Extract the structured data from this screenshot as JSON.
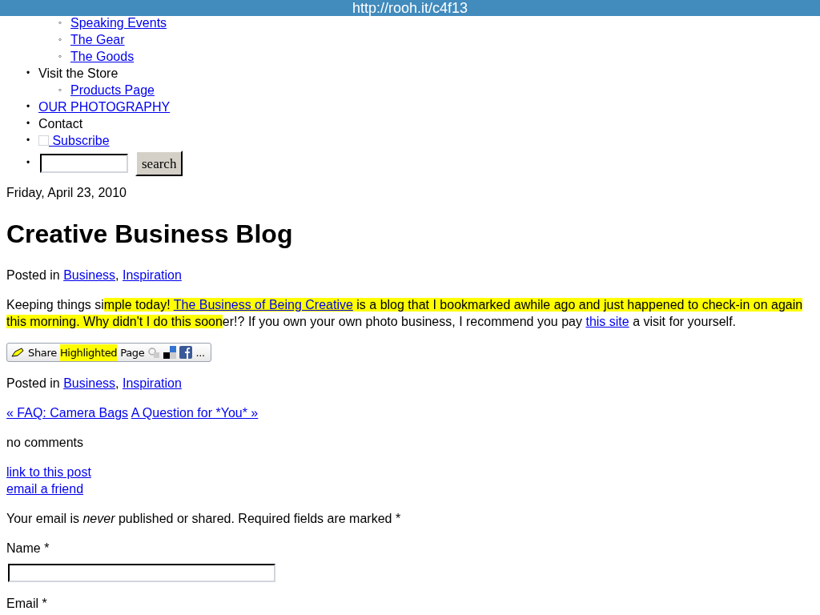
{
  "top_bar": {
    "url": "http://rooh.it/c4f13"
  },
  "nav": [
    {
      "marker": "◦",
      "label": "Speaking Events",
      "kind": "link"
    },
    {
      "marker": "◦",
      "label": "The Gear",
      "kind": "link"
    },
    {
      "marker": "◦",
      "label": "The Goods",
      "kind": "link"
    }
  ],
  "nav_main": [
    {
      "marker": "•",
      "label": "Visit the Store",
      "kind": "text",
      "children": [
        {
          "marker": "◦",
          "label": "Products Page",
          "kind": "link"
        }
      ]
    },
    {
      "marker": "•",
      "label": "OUR PHOTOGRAPHY",
      "kind": "link"
    },
    {
      "marker": "•",
      "label": "Contact",
      "kind": "text"
    },
    {
      "marker": "•",
      "label": " Subscribe",
      "kind": "feed_link"
    }
  ],
  "search": {
    "marker": "•",
    "button": "search"
  },
  "date": "Friday, April 23, 2010",
  "title": "Creative Business Blog",
  "posted_in": {
    "label": "Posted in",
    "separator": ",",
    "categories": [
      "Business",
      "Inspiration"
    ]
  },
  "body": [
    {
      "text": "Keeping things si",
      "highlighted": false,
      "kind": "text"
    },
    {
      "text": "mple today! ",
      "highlighted": true,
      "kind": "text"
    },
    {
      "text": "The Business of Being Creative",
      "highlighted": true,
      "kind": "link"
    },
    {
      "text": " is a blog that I bookmarked awhile ago and just happened to check-in on again this morning. Why didn't I do this soon",
      "highlighted": true,
      "kind": "text"
    },
    {
      "text": "er!? If you own your own photo business, I recommend you pay ",
      "highlighted": false,
      "kind": "text"
    },
    {
      "text": "this site",
      "highlighted": false,
      "kind": "link"
    },
    {
      "text": " a visit for yourself.",
      "highlighted": false,
      "kind": "text"
    }
  ],
  "share": {
    "parts": [
      {
        "text": "Share",
        "highlighted": false
      },
      {
        "text": "Highlighted",
        "highlighted": true
      },
      {
        "text": "Page",
        "highlighted": false
      }
    ],
    "more": "..."
  },
  "posted_in_bottom": {
    "label": "Posted in",
    "separator": ",",
    "categories": [
      "Business",
      "Inspiration"
    ]
  },
  "post_nav": [
    "« FAQ: Camera Bags",
    "A Question for *You* »"
  ],
  "comments": "no comments",
  "post_links": [
    "link to this post",
    "email a friend"
  ],
  "notice": "Your email is *never* published or shared. Required fields are marked *",
  "fields": [
    {
      "label": "Name *",
      "kind": "text_input"
    },
    {
      "label": "Email *",
      "kind": "label_only"
    }
  ]
}
